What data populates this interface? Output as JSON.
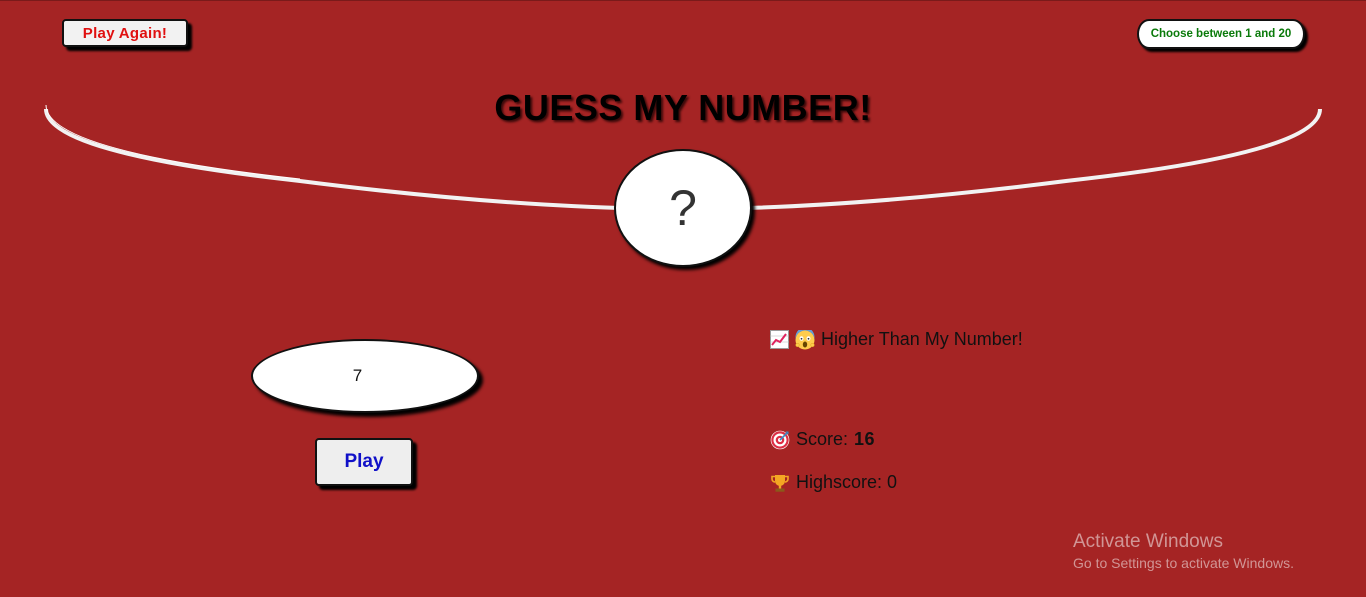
{
  "header": {
    "play_again_label": "Play Again!",
    "range_hint": "Choose between 1 and 20",
    "title": "GUESS MY NUMBER!"
  },
  "secret": {
    "display": "?"
  },
  "guess": {
    "value": "7"
  },
  "controls": {
    "play_label": "Play"
  },
  "status": {
    "message": "Higher Than My Number!",
    "message_icons": [
      "chart-increasing-icon",
      "screaming-face-icon"
    ],
    "score_label": "Score:",
    "score_value": "16",
    "score_icon": "target-icon",
    "highscore_label": "Highscore:",
    "highscore_value": "0",
    "highscore_icon": "trophy-icon"
  },
  "watermark": {
    "title": "Activate Windows",
    "subtitle": "Go to Settings to activate Windows."
  },
  "colors": {
    "background": "#a52424",
    "play_again_text": "#e01010",
    "range_hint_text": "#0a7a0a",
    "play_text": "#1010c8"
  }
}
